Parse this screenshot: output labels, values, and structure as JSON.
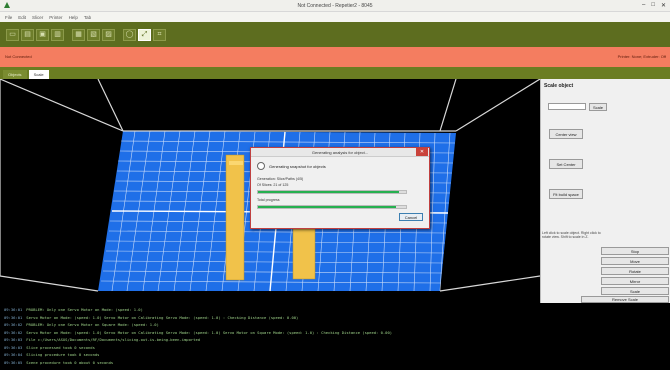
{
  "window": {
    "title": "Not Connected - Repetier2 - 8045"
  },
  "menu": [
    "File",
    "Edit",
    "Slicer",
    "Printer",
    "Help",
    "Tab"
  ],
  "toolbar": {
    "icons": [
      "load-icon",
      "save-icon",
      "open-icon",
      "print-icon",
      "stop-icon",
      "jog-icon",
      "view-icon",
      "lock-icon",
      "zoom-icon",
      "frame-icon",
      "move-icon",
      "rotate-icon"
    ]
  },
  "status": {
    "left": "Not Connected",
    "right": "Printer: None; Extruder: Off"
  },
  "tabs": [
    {
      "label": "Objects"
    },
    {
      "label": "Scale"
    }
  ],
  "right_panel": {
    "heading": "Scale object",
    "scale_value": "",
    "apply_label": "Scale",
    "buttons": [
      "Center view",
      "Set Center",
      "Fit build space"
    ],
    "hint": "Left click to scale object. Right click to rotate view. Shift to scale in Z.",
    "actions": [
      "Stop",
      "Move",
      "Rotate",
      "Mirror",
      "Scale",
      "Remove Scale"
    ]
  },
  "dialog": {
    "title": "Generating analysis for object...",
    "message": "Generating snapshot for objects",
    "line1": "Generation: Slice/Paths (4/5)",
    "line2": "Of Slices: 21 of 125",
    "bar1_progress": 0.95,
    "line3": "Total progress",
    "bar2_progress": 0.93,
    "cancel_label": "Cancel"
  },
  "console": [
    {
      "time": "09:36:01",
      "text": "PROBLEM: Only one Servo Motor on Mode: (speed: 1.0)"
    },
    {
      "time": "09:36:01",
      "text": "Servo Motor on Mode: (speed: 1.0) Servo Motor on Calibrating Servo Mode: (speed: 1.0) : Checking Distance (speed: 0.00)"
    },
    {
      "time": "09:36:02",
      "text": "PROBLEM: Only one Servo Motor on Square Mode: (speed: 1.0)"
    },
    {
      "time": "09:36:02",
      "text": "Servo Motor on Mode: (speed: 1.0) Servo Motor on Calibrating Servo Mode: (speed: 1.0) Servo Motor on Square Mode: (speed: 1.0) : Checking Distance (speed: 0.00)"
    },
    {
      "time": "09:36:03",
      "text": "File c:/Users/ASUS/Documents/RF/Documents/slicing-out-is-being-been-imported"
    },
    {
      "time": "09:36:03",
      "text": "Slice processed took 0 seconds"
    },
    {
      "time": "09:36:04",
      "text": "Slicing procedure took 0 seconds"
    },
    {
      "time": "09:36:05",
      "text": "Scene procedure took 0 about 0 seconds"
    }
  ],
  "colors": {
    "toolbar": "#5d6d1f",
    "status": "#f47d60",
    "grid": "#1f6fe8",
    "objects": "#f1c24a",
    "progress": "#26b050"
  }
}
